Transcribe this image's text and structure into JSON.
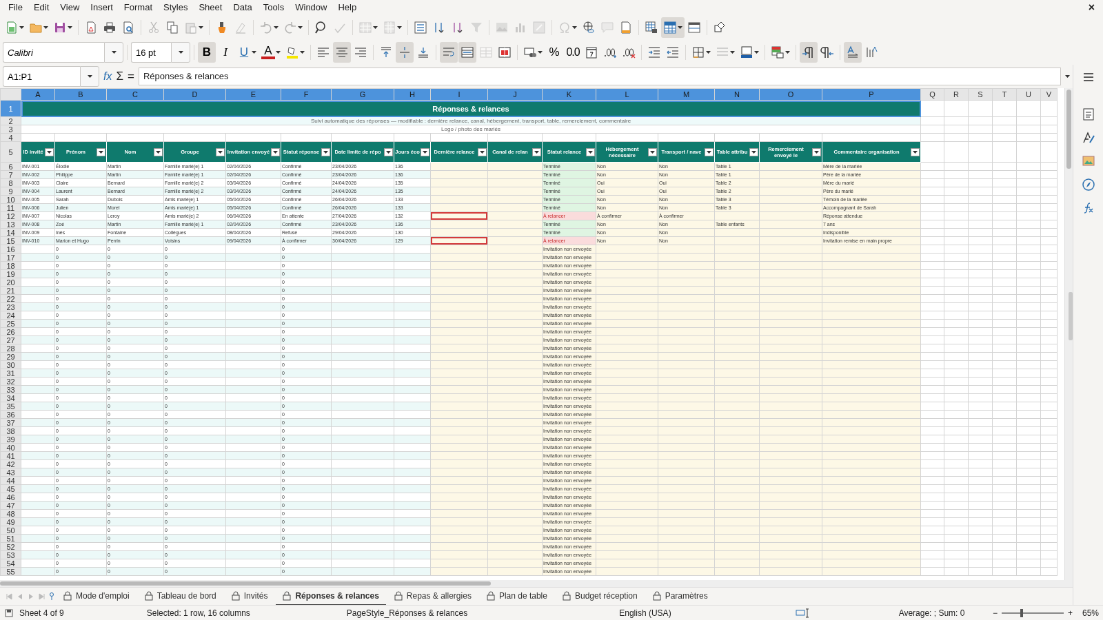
{
  "window": {
    "close": "×"
  },
  "menu": [
    "File",
    "Edit",
    "View",
    "Insert",
    "Format",
    "Styles",
    "Sheet",
    "Data",
    "Tools",
    "Window",
    "Help"
  ],
  "toolbar_1": [
    [
      {
        "kind": "new",
        "dropdown": true,
        "disabled": false,
        "pressed": false
      },
      {
        "kind": "open",
        "dropdown": true,
        "disabled": false,
        "pressed": false
      },
      {
        "kind": "save",
        "dropdown": true,
        "disabled": false,
        "pressed": false
      }
    ],
    [
      {
        "kind": "pdf",
        "dropdown": false,
        "disabled": false,
        "pressed": false
      },
      {
        "kind": "print",
        "dropdown": false,
        "disabled": false,
        "pressed": false
      },
      {
        "kind": "preview",
        "dropdown": false,
        "disabled": false,
        "pressed": false
      }
    ],
    [
      {
        "kind": "cut",
        "dropdown": false,
        "disabled": true,
        "pressed": false
      },
      {
        "kind": "copy",
        "dropdown": false,
        "disabled": false,
        "pressed": false
      },
      {
        "kind": "paste",
        "dropdown": true,
        "disabled": true,
        "pressed": false
      }
    ],
    [
      {
        "kind": "clone",
        "dropdown": false,
        "disabled": false,
        "pressed": false
      },
      {
        "kind": "clear",
        "dropdown": false,
        "disabled": true,
        "pressed": false
      }
    ],
    [
      {
        "kind": "undo",
        "dropdown": true,
        "disabled": true,
        "pressed": false
      },
      {
        "kind": "redo",
        "dropdown": true,
        "disabled": true,
        "pressed": false
      }
    ],
    [
      {
        "kind": "find",
        "dropdown": false,
        "disabled": false,
        "pressed": false
      },
      {
        "kind": "spell",
        "dropdown": false,
        "disabled": true,
        "pressed": false
      }
    ],
    [
      {
        "kind": "row",
        "dropdown": true,
        "disabled": true,
        "pressed": false
      },
      {
        "kind": "col",
        "dropdown": true,
        "disabled": true,
        "pressed": false
      }
    ],
    [
      {
        "kind": "sort",
        "dropdown": false,
        "disabled": false,
        "pressed": false
      },
      {
        "kind": "asc",
        "dropdown": false,
        "disabled": false,
        "pressed": false
      },
      {
        "kind": "desc",
        "dropdown": false,
        "disabled": false,
        "pressed": false
      },
      {
        "kind": "filter",
        "dropdown": false,
        "disabled": true,
        "pressed": false
      }
    ],
    [
      {
        "kind": "image",
        "dropdown": false,
        "disabled": true,
        "pressed": false
      },
      {
        "kind": "chart",
        "dropdown": false,
        "disabled": true,
        "pressed": false
      },
      {
        "kind": "pivot",
        "dropdown": false,
        "disabled": true,
        "pressed": false
      }
    ],
    [
      {
        "kind": "special",
        "dropdown": true,
        "disabled": true,
        "pressed": false
      },
      {
        "kind": "link",
        "dropdown": false,
        "disabled": false,
        "pressed": false
      },
      {
        "kind": "comment",
        "dropdown": false,
        "disabled": true,
        "pressed": false
      },
      {
        "kind": "hf",
        "dropdown": false,
        "disabled": false,
        "pressed": false
      }
    ],
    [
      {
        "kind": "printarea",
        "dropdown": false,
        "disabled": false,
        "pressed": false
      },
      {
        "kind": "freeze",
        "dropdown": true,
        "disabled": false,
        "pressed": true
      },
      {
        "kind": "split",
        "dropdown": false,
        "disabled": false,
        "pressed": false
      }
    ],
    [
      {
        "kind": "shapes",
        "dropdown": false,
        "disabled": false,
        "pressed": false
      }
    ]
  ],
  "font_name": "Calibri",
  "font_size": "16 pt",
  "toolbar_2": [
    [
      {
        "kind": "bold",
        "label": "B",
        "dropdown": false,
        "disabled": false,
        "pressed": true
      },
      {
        "kind": "italic",
        "label": "I",
        "dropdown": false,
        "disabled": false,
        "pressed": false
      },
      {
        "kind": "underline",
        "label": "U",
        "dropdown": true,
        "disabled": false,
        "pressed": false
      },
      {
        "kind": "fontcolor",
        "label": "A",
        "dropdown": true,
        "disabled": false,
        "pressed": false
      },
      {
        "kind": "highlight",
        "dropdown": true,
        "disabled": false,
        "pressed": false
      }
    ],
    [
      {
        "kind": "al",
        "dropdown": false,
        "disabled": false,
        "pressed": false
      },
      {
        "kind": "ac",
        "dropdown": false,
        "disabled": false,
        "pressed": true
      },
      {
        "kind": "ar",
        "dropdown": false,
        "disabled": false,
        "pressed": false
      }
    ],
    [
      {
        "kind": "at",
        "dropdown": false,
        "disabled": false,
        "pressed": false
      },
      {
        "kind": "am",
        "dropdown": false,
        "disabled": false,
        "pressed": true
      },
      {
        "kind": "ab",
        "dropdown": false,
        "disabled": false,
        "pressed": false
      }
    ],
    [
      {
        "kind": "wrap",
        "dropdown": false,
        "disabled": false,
        "pressed": true
      },
      {
        "kind": "mergec",
        "dropdown": false,
        "disabled": false,
        "pressed": true
      },
      {
        "kind": "merge",
        "dropdown": false,
        "disabled": true,
        "pressed": false
      },
      {
        "kind": "unmerge",
        "dropdown": false,
        "disabled": false,
        "pressed": false
      }
    ],
    [
      {
        "kind": "currency",
        "dropdown": true,
        "disabled": false,
        "pressed": false
      },
      {
        "kind": "percent",
        "label": "%",
        "dropdown": false,
        "disabled": false,
        "pressed": false
      },
      {
        "kind": "number",
        "label": "0.0",
        "dropdown": false,
        "disabled": false,
        "pressed": false
      },
      {
        "kind": "date",
        "dropdown": false,
        "disabled": false,
        "pressed": false
      },
      {
        "kind": "adddec",
        "dropdown": false,
        "disabled": false,
        "pressed": false
      },
      {
        "kind": "deldec",
        "dropdown": false,
        "disabled": false,
        "pressed": false
      }
    ],
    [
      {
        "kind": "indin",
        "dropdown": false,
        "disabled": false,
        "pressed": false
      },
      {
        "kind": "indout",
        "dropdown": false,
        "disabled": false,
        "pressed": false
      }
    ],
    [
      {
        "kind": "borders",
        "dropdown": true,
        "disabled": false,
        "pressed": false
      },
      {
        "kind": "bstyle",
        "dropdown": true,
        "disabled": true,
        "pressed": false
      },
      {
        "kind": "bcolor",
        "dropdown": true,
        "disabled": false,
        "pressed": false
      }
    ],
    [
      {
        "kind": "cond",
        "dropdown": true,
        "disabled": false,
        "pressed": false
      }
    ],
    [
      {
        "kind": "ltr",
        "dropdown": false,
        "disabled": false,
        "pressed": true
      },
      {
        "kind": "rtl",
        "dropdown": false,
        "disabled": false,
        "pressed": false
      }
    ],
    [
      {
        "kind": "tdir",
        "dropdown": false,
        "disabled": false,
        "pressed": true
      },
      {
        "kind": "vert",
        "dropdown": false,
        "disabled": false,
        "pressed": false
      }
    ]
  ],
  "formula_bar": {
    "name_box": "A1:P1",
    "wizard": "fx",
    "sum": "Σ",
    "equals": "=",
    "content": "Réponses & relances"
  },
  "columns": [
    {
      "letter": "A",
      "selected": true
    },
    {
      "letter": "B",
      "selected": true
    },
    {
      "letter": "C",
      "selected": true
    },
    {
      "letter": "D",
      "selected": true
    },
    {
      "letter": "E",
      "selected": true
    },
    {
      "letter": "F",
      "selected": true
    },
    {
      "letter": "G",
      "selected": true
    },
    {
      "letter": "H",
      "selected": true
    },
    {
      "letter": "I",
      "selected": true
    },
    {
      "letter": "J",
      "selected": true
    },
    {
      "letter": "K",
      "selected": true
    },
    {
      "letter": "L",
      "selected": true
    },
    {
      "letter": "M",
      "selected": true
    },
    {
      "letter": "N",
      "selected": true
    },
    {
      "letter": "O",
      "selected": true
    },
    {
      "letter": "P",
      "selected": true
    },
    {
      "letter": "Q",
      "selected": false
    },
    {
      "letter": "R",
      "selected": false
    },
    {
      "letter": "S",
      "selected": false
    },
    {
      "letter": "T",
      "selected": false
    },
    {
      "letter": "U",
      "selected": false
    },
    {
      "letter": "V",
      "selected": false
    }
  ],
  "top_rows": [
    {
      "num": "1",
      "selected": true
    },
    {
      "num": "2",
      "selected": false
    },
    {
      "num": "3",
      "selected": false
    },
    {
      "num": "4",
      "selected": false
    },
    {
      "num": "5",
      "selected": false
    }
  ],
  "title": "Réponses & relances",
  "subtitle": "Suivi automatique des réponses — modifiable : dernière relance, canal, hébergement, transport, table, remerciement, commentaire",
  "logo_placeholder": "Logo / photo des mariés",
  "headers": [
    "ID invité",
    "Prénom",
    "Nom",
    "Groupe",
    "Invitation envoyé",
    "Statut réponse",
    "Date limite de répo",
    "Jours éco",
    "Dernière relance",
    "Canal de relan",
    "Statut relance",
    "Hébergement nécessaire",
    "Transport / nave",
    "Table attribu",
    "Remerciement envoyé le",
    "Commentaire organisation"
  ],
  "rows": [
    {
      "num": "6",
      "selected": false,
      "flagged": false,
      "kind": "done",
      "cells": {
        "A": "INV-001",
        "B": "Élodie",
        "C": "Martin",
        "D": "Famille marié(e) 1",
        "E": "02/04/2026",
        "F": "Confirmé",
        "G": "23/04/2026",
        "H": "136",
        "K": "Terminé",
        "L": "Non",
        "M": "Non",
        "N": "Table 1",
        "P": "Mère de la mariée"
      }
    },
    {
      "num": "7",
      "selected": false,
      "flagged": false,
      "kind": "done",
      "cells": {
        "A": "INV-002",
        "B": "Philippe",
        "C": "Martin",
        "D": "Famille marié(e) 1",
        "E": "02/04/2026",
        "F": "Confirmé",
        "G": "23/04/2026",
        "H": "136",
        "K": "Terminé",
        "L": "Non",
        "M": "Non",
        "N": "Table 1",
        "P": "Père de la mariée"
      }
    },
    {
      "num": "8",
      "selected": false,
      "flagged": false,
      "kind": "done",
      "cells": {
        "A": "INV-003",
        "B": "Claire",
        "C": "Bernard",
        "D": "Famille marié(e) 2",
        "E": "03/04/2026",
        "F": "Confirmé",
        "G": "24/04/2026",
        "H": "135",
        "K": "Terminé",
        "L": "Oui",
        "M": "Oui",
        "N": "Table 2",
        "P": "Mère du marié"
      }
    },
    {
      "num": "9",
      "selected": false,
      "flagged": false,
      "kind": "done",
      "cells": {
        "A": "INV-004",
        "B": "Laurent",
        "C": "Bernard",
        "D": "Famille marié(e) 2",
        "E": "03/04/2026",
        "F": "Confirmé",
        "G": "24/04/2026",
        "H": "135",
        "K": "Terminé",
        "L": "Oui",
        "M": "Oui",
        "N": "Table 2",
        "P": "Père du marié"
      }
    },
    {
      "num": "10",
      "selected": false,
      "flagged": false,
      "kind": "done",
      "cells": {
        "A": "INV-005",
        "B": "Sarah",
        "C": "Dubois",
        "D": "Amis marié(e) 1",
        "E": "05/04/2026",
        "F": "Confirmé",
        "G": "26/04/2026",
        "H": "133",
        "K": "Terminé",
        "L": "Non",
        "M": "Non",
        "N": "Table 3",
        "P": "Témoin de la mariée"
      }
    },
    {
      "num": "11",
      "selected": false,
      "flagged": false,
      "kind": "done",
      "cells": {
        "A": "INV-006",
        "B": "Julien",
        "C": "Morel",
        "D": "Amis marié(e) 1",
        "E": "05/04/2026",
        "F": "Confirmé",
        "G": "26/04/2026",
        "H": "133",
        "K": "Terminé",
        "L": "Non",
        "M": "Non",
        "N": "Table 3",
        "P": "Accompagnant de Sarah"
      }
    },
    {
      "num": "12",
      "selected": false,
      "flagged": true,
      "kind": "relaunch",
      "cells": {
        "A": "INV-007",
        "B": "Nicolas",
        "C": "Leroy",
        "D": "Amis marié(e) 2",
        "E": "06/04/2026",
        "F": "En attente",
        "G": "27/04/2026",
        "H": "132",
        "K": "À relancer",
        "L": "À confirmer",
        "M": "À confirmer",
        "P": "Réponse attendue"
      }
    },
    {
      "num": "13",
      "selected": false,
      "flagged": false,
      "kind": "done",
      "cells": {
        "A": "INV-008",
        "B": "Zoé",
        "C": "Martin",
        "D": "Famille marié(e) 1",
        "E": "02/04/2026",
        "F": "Confirmé",
        "G": "23/04/2026",
        "H": "136",
        "K": "Terminé",
        "L": "Non",
        "M": "Non",
        "N": "Table enfants",
        "P": "7 ans"
      }
    },
    {
      "num": "14",
      "selected": false,
      "flagged": false,
      "kind": "done",
      "cells": {
        "A": "INV-009",
        "B": "Inès",
        "C": "Fontaine",
        "D": "Collègues",
        "E": "08/04/2026",
        "F": "Refusé",
        "G": "29/04/2026",
        "H": "130",
        "K": "Terminé",
        "L": "Non",
        "M": "Non",
        "P": "Indisponible"
      }
    },
    {
      "num": "15",
      "selected": false,
      "flagged": true,
      "kind": "relaunch",
      "cells": {
        "A": "INV-010",
        "B": "Marion et Hugo",
        "C": "Perrin",
        "D": "Voisins",
        "E": "09/04/2026",
        "F": "À confirmer",
        "G": "30/04/2026",
        "H": "129",
        "K": "À relancer",
        "L": "Non",
        "M": "Non",
        "P": "Invitation remise en main propre"
      }
    },
    {
      "num": "16",
      "selected": false,
      "flagged": false,
      "kind": "none",
      "cells": {
        "B": "0",
        "C": "0",
        "D": "0",
        "F": "0",
        "K": "Invitation non envoyée"
      }
    },
    {
      "num": "17",
      "selected": false,
      "flagged": false,
      "kind": "none",
      "cells": {
        "B": "0",
        "C": "0",
        "D": "0",
        "F": "0",
        "K": "Invitation non envoyée"
      }
    },
    {
      "num": "18",
      "selected": false,
      "flagged": false,
      "kind": "none",
      "cells": {
        "B": "0",
        "C": "0",
        "D": "0",
        "F": "0",
        "K": "Invitation non envoyée"
      }
    },
    {
      "num": "19",
      "selected": false,
      "flagged": false,
      "kind": "none",
      "cells": {
        "B": "0",
        "C": "0",
        "D": "0",
        "F": "0",
        "K": "Invitation non envoyée"
      }
    },
    {
      "num": "20",
      "selected": false,
      "flagged": false,
      "kind": "none",
      "cells": {
        "B": "0",
        "C": "0",
        "D": "0",
        "F": "0",
        "K": "Invitation non envoyée"
      }
    },
    {
      "num": "21",
      "selected": false,
      "flagged": false,
      "kind": "none",
      "cells": {
        "B": "0",
        "C": "0",
        "D": "0",
        "F": "0",
        "K": "Invitation non envoyée"
      }
    },
    {
      "num": "22",
      "selected": false,
      "flagged": false,
      "kind": "none",
      "cells": {
        "B": "0",
        "C": "0",
        "D": "0",
        "F": "0",
        "K": "Invitation non envoyée"
      }
    },
    {
      "num": "23",
      "selected": false,
      "flagged": false,
      "kind": "none",
      "cells": {
        "B": "0",
        "C": "0",
        "D": "0",
        "F": "0",
        "K": "Invitation non envoyée"
      }
    },
    {
      "num": "24",
      "selected": false,
      "flagged": false,
      "kind": "none",
      "cells": {
        "B": "0",
        "C": "0",
        "D": "0",
        "F": "0",
        "K": "Invitation non envoyée"
      }
    },
    {
      "num": "25",
      "selected": false,
      "flagged": false,
      "kind": "none",
      "cells": {
        "B": "0",
        "C": "0",
        "D": "0",
        "F": "0",
        "K": "Invitation non envoyée"
      }
    },
    {
      "num": "26",
      "selected": false,
      "flagged": false,
      "kind": "none",
      "cells": {
        "B": "0",
        "C": "0",
        "D": "0",
        "F": "0",
        "K": "Invitation non envoyée"
      }
    },
    {
      "num": "27",
      "selected": false,
      "flagged": false,
      "kind": "none",
      "cells": {
        "B": "0",
        "C": "0",
        "D": "0",
        "F": "0",
        "K": "Invitation non envoyée"
      }
    },
    {
      "num": "28",
      "selected": false,
      "flagged": false,
      "kind": "none",
      "cells": {
        "B": "0",
        "C": "0",
        "D": "0",
        "F": "0",
        "K": "Invitation non envoyée"
      }
    },
    {
      "num": "29",
      "selected": false,
      "flagged": false,
      "kind": "none",
      "cells": {
        "B": "0",
        "C": "0",
        "D": "0",
        "F": "0",
        "K": "Invitation non envoyée"
      }
    },
    {
      "num": "30",
      "selected": false,
      "flagged": false,
      "kind": "none",
      "cells": {
        "B": "0",
        "C": "0",
        "D": "0",
        "F": "0",
        "K": "Invitation non envoyée"
      }
    },
    {
      "num": "31",
      "selected": false,
      "flagged": false,
      "kind": "none",
      "cells": {
        "B": "0",
        "C": "0",
        "D": "0",
        "F": "0",
        "K": "Invitation non envoyée"
      }
    },
    {
      "num": "32",
      "selected": false,
      "flagged": false,
      "kind": "none",
      "cells": {
        "B": "0",
        "C": "0",
        "D": "0",
        "F": "0",
        "K": "Invitation non envoyée"
      }
    },
    {
      "num": "33",
      "selected": false,
      "flagged": false,
      "kind": "none",
      "cells": {
        "B": "0",
        "C": "0",
        "D": "0",
        "F": "0",
        "K": "Invitation non envoyée"
      }
    },
    {
      "num": "34",
      "selected": false,
      "flagged": false,
      "kind": "none",
      "cells": {
        "B": "0",
        "C": "0",
        "D": "0",
        "F": "0",
        "K": "Invitation non envoyée"
      }
    },
    {
      "num": "35",
      "selected": false,
      "flagged": false,
      "kind": "none",
      "cells": {
        "B": "0",
        "C": "0",
        "D": "0",
        "F": "0",
        "K": "Invitation non envoyée"
      }
    },
    {
      "num": "36",
      "selected": false,
      "flagged": false,
      "kind": "none",
      "cells": {
        "B": "0",
        "C": "0",
        "D": "0",
        "F": "0",
        "K": "Invitation non envoyée"
      }
    },
    {
      "num": "37",
      "selected": false,
      "flagged": false,
      "kind": "none",
      "cells": {
        "B": "0",
        "C": "0",
        "D": "0",
        "F": "0",
        "K": "Invitation non envoyée"
      }
    },
    {
      "num": "38",
      "selected": false,
      "flagged": false,
      "kind": "none",
      "cells": {
        "B": "0",
        "C": "0",
        "D": "0",
        "F": "0",
        "K": "Invitation non envoyée"
      }
    },
    {
      "num": "39",
      "selected": false,
      "flagged": false,
      "kind": "none",
      "cells": {
        "B": "0",
        "C": "0",
        "D": "0",
        "F": "0",
        "K": "Invitation non envoyée"
      }
    },
    {
      "num": "40",
      "selected": false,
      "flagged": false,
      "kind": "none",
      "cells": {
        "B": "0",
        "C": "0",
        "D": "0",
        "F": "0",
        "K": "Invitation non envoyée"
      }
    },
    {
      "num": "41",
      "selected": false,
      "flagged": false,
      "kind": "none",
      "cells": {
        "B": "0",
        "C": "0",
        "D": "0",
        "F": "0",
        "K": "Invitation non envoyée"
      }
    },
    {
      "num": "42",
      "selected": false,
      "flagged": false,
      "kind": "none",
      "cells": {
        "B": "0",
        "C": "0",
        "D": "0",
        "F": "0",
        "K": "Invitation non envoyée"
      }
    },
    {
      "num": "43",
      "selected": false,
      "flagged": false,
      "kind": "none",
      "cells": {
        "B": "0",
        "C": "0",
        "D": "0",
        "F": "0",
        "K": "Invitation non envoyée"
      }
    },
    {
      "num": "44",
      "selected": false,
      "flagged": false,
      "kind": "none",
      "cells": {
        "B": "0",
        "C": "0",
        "D": "0",
        "F": "0",
        "K": "Invitation non envoyée"
      }
    },
    {
      "num": "45",
      "selected": false,
      "flagged": false,
      "kind": "none",
      "cells": {
        "B": "0",
        "C": "0",
        "D": "0",
        "F": "0",
        "K": "Invitation non envoyée"
      }
    },
    {
      "num": "46",
      "selected": false,
      "flagged": false,
      "kind": "none",
      "cells": {
        "B": "0",
        "C": "0",
        "D": "0",
        "F": "0",
        "K": "Invitation non envoyée"
      }
    },
    {
      "num": "47",
      "selected": false,
      "flagged": false,
      "kind": "none",
      "cells": {
        "B": "0",
        "C": "0",
        "D": "0",
        "F": "0",
        "K": "Invitation non envoyée"
      }
    },
    {
      "num": "48",
      "selected": false,
      "flagged": false,
      "kind": "none",
      "cells": {
        "B": "0",
        "C": "0",
        "D": "0",
        "F": "0",
        "K": "Invitation non envoyée"
      }
    },
    {
      "num": "49",
      "selected": false,
      "flagged": false,
      "kind": "none",
      "cells": {
        "B": "0",
        "C": "0",
        "D": "0",
        "F": "0",
        "K": "Invitation non envoyée"
      }
    },
    {
      "num": "50",
      "selected": false,
      "flagged": false,
      "kind": "none",
      "cells": {
        "B": "0",
        "C": "0",
        "D": "0",
        "F": "0",
        "K": "Invitation non envoyée"
      }
    },
    {
      "num": "51",
      "selected": false,
      "flagged": false,
      "kind": "none",
      "cells": {
        "B": "0",
        "C": "0",
        "D": "0",
        "F": "0",
        "K": "Invitation non envoyée"
      }
    },
    {
      "num": "52",
      "selected": false,
      "flagged": false,
      "kind": "none",
      "cells": {
        "B": "0",
        "C": "0",
        "D": "0",
        "F": "0",
        "K": "Invitation non envoyée"
      }
    },
    {
      "num": "53",
      "selected": false,
      "flagged": false,
      "kind": "none",
      "cells": {
        "B": "0",
        "C": "0",
        "D": "0",
        "F": "0",
        "K": "Invitation non envoyée"
      }
    },
    {
      "num": "54",
      "selected": false,
      "flagged": false,
      "kind": "none",
      "cells": {
        "B": "0",
        "C": "0",
        "D": "0",
        "F": "0",
        "K": "Invitation non envoyée"
      }
    },
    {
      "num": "55",
      "selected": false,
      "flagged": false,
      "kind": "none",
      "cells": {
        "B": "0",
        "C": "0",
        "D": "0",
        "F": "0",
        "K": "Invitation non envoyée"
      }
    }
  ],
  "tabs": [
    {
      "label": "Mode d'emploi",
      "selected": false
    },
    {
      "label": "Tableau de bord",
      "selected": false
    },
    {
      "label": "Invités",
      "selected": false
    },
    {
      "label": "Réponses & relances",
      "selected": true
    },
    {
      "label": "Repas & allergies",
      "selected": false
    },
    {
      "label": "Plan de table",
      "selected": false
    },
    {
      "label": "Budget réception",
      "selected": false
    },
    {
      "label": "Paramètres",
      "selected": false
    }
  ],
  "status_bar": {
    "sheet": "Sheet 4 of 9",
    "selection": "Selected: 1 row, 16 columns",
    "page_style": "PageStyle_Réponses & relances",
    "language": "English (USA)",
    "summary": "Average: ; Sum: 0",
    "zoom_out": "−",
    "zoom_in": "+",
    "zoom": {
      "level": 0.3
    },
    "zoom_text": "65%"
  }
}
